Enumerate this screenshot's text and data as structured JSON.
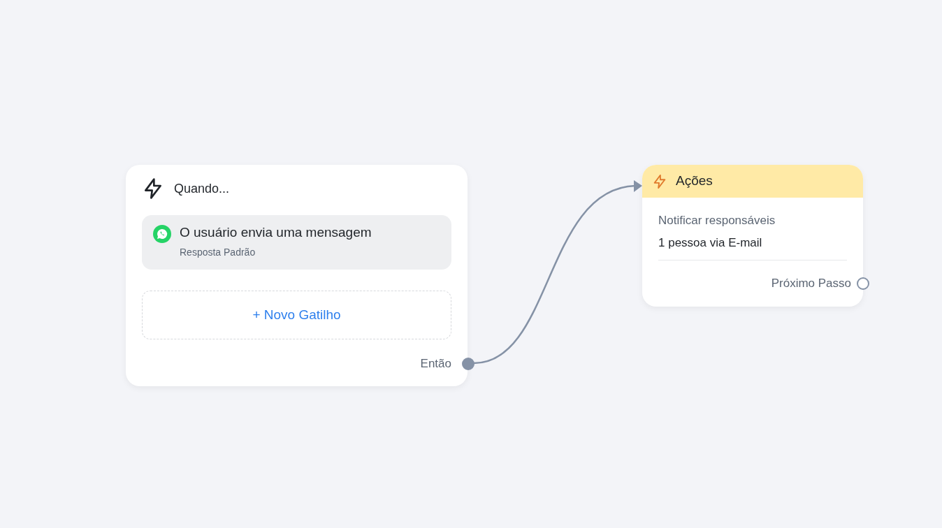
{
  "trigger_node": {
    "title": "Quando...",
    "triggers": [
      {
        "title": "O usuário envia uma mensagem",
        "subtitle": "Resposta Padrão"
      }
    ],
    "add_button": "+ Novo Gatilho",
    "output": {
      "label": "Então",
      "connected": true
    }
  },
  "action_node": {
    "title": "Ações",
    "actions": [
      {
        "title": "Notificar responsáveis",
        "detail": "1 pessoa via E-mail"
      }
    ],
    "output": {
      "label": "Próximo Passo",
      "connected": false
    }
  }
}
